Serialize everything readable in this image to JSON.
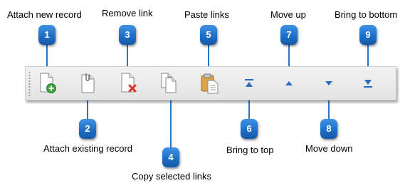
{
  "toolbar": {
    "buttons": [
      {
        "id": 1,
        "badge": "1",
        "label": "Attach new record",
        "icon": "document-add-icon"
      },
      {
        "id": 2,
        "badge": "2",
        "label": "Attach existing record",
        "icon": "document-attach-icon"
      },
      {
        "id": 3,
        "badge": "3",
        "label": "Remove link",
        "icon": "document-remove-icon"
      },
      {
        "id": 4,
        "badge": "4",
        "label": "Copy selected links",
        "icon": "copy-icon"
      },
      {
        "id": 5,
        "badge": "5",
        "label": "Paste links",
        "icon": "paste-icon"
      },
      {
        "id": 6,
        "badge": "6",
        "label": "Bring to top",
        "icon": "bring-to-top-icon"
      },
      {
        "id": 7,
        "badge": "7",
        "label": "Move up",
        "icon": "move-up-icon"
      },
      {
        "id": 8,
        "badge": "8",
        "label": "Move down",
        "icon": "move-down-icon"
      },
      {
        "id": 9,
        "badge": "9",
        "label": "Bring to bottom",
        "icon": "bring-to-bottom-icon"
      }
    ]
  },
  "colors": {
    "badge": "#1f6ec7",
    "connector": "#2777c8",
    "arrow": "#2a6cc4",
    "add": "#3aa63a",
    "remove": "#d9342b"
  }
}
